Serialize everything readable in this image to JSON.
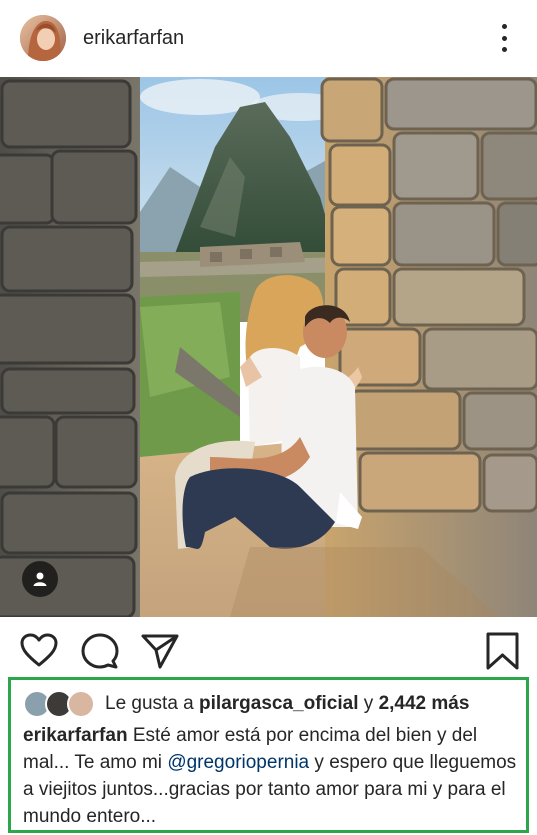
{
  "header": {
    "username": "erikarfarfan",
    "avatar_icon": "profile-avatar",
    "more_icon": "more-vertical-icon"
  },
  "post": {
    "image_alt": "couple sitting between stone walls at Machu Picchu",
    "user_tag_icon": "user-tag-icon"
  },
  "actions": {
    "like_icon": "heart-icon",
    "comment_icon": "comment-icon",
    "share_icon": "send-icon",
    "save_icon": "bookmark-icon"
  },
  "likes": {
    "prefix": "Le gusta a",
    "user": "pilargasca_oficial",
    "connector": "y",
    "count": "2,442 más"
  },
  "caption": {
    "author": "erikarfarfan",
    "text_before": "Esté amor está por encima del bien y del mal... Te amo mi ",
    "mention": "@gregoriopernia",
    "text_after": " y espero que lleguemos a viejitos juntos...gracias por tanto amor para mi y para el mundo entero..."
  },
  "colors": {
    "highlight_border": "#2ca64a",
    "mention": "#003569",
    "text": "#262626"
  }
}
